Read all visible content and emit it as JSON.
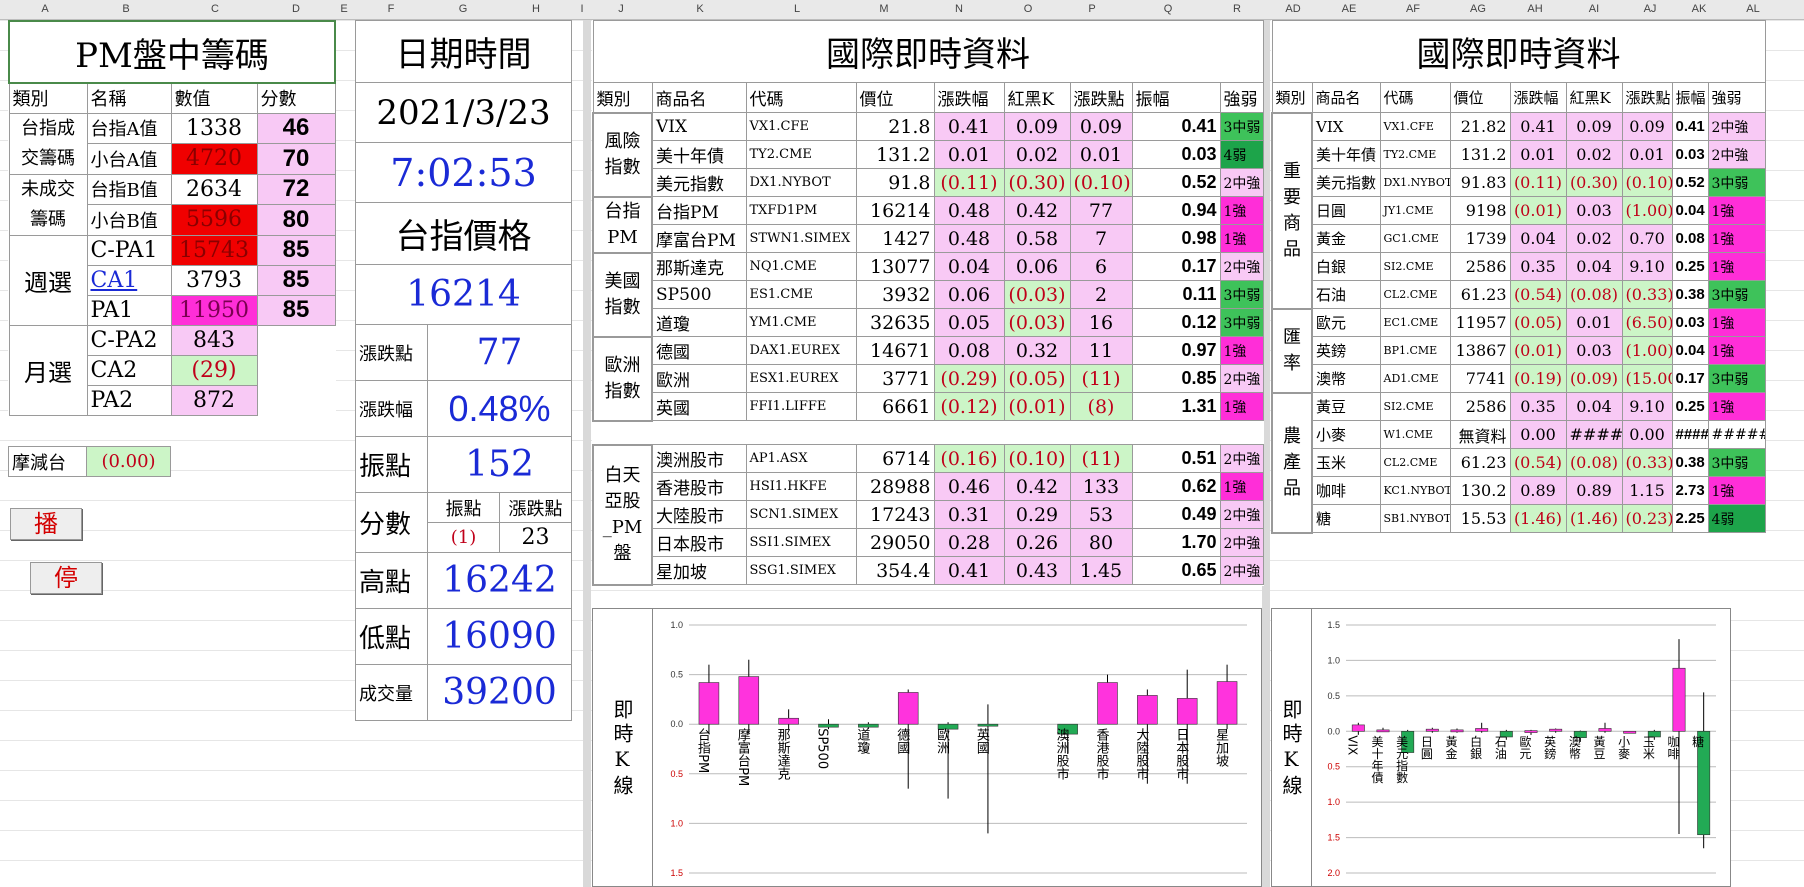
{
  "column_letters": [
    "A",
    "B",
    "C",
    "D",
    "E",
    "F",
    "G",
    "H",
    "I",
    "J",
    "K",
    "L",
    "M",
    "N",
    "O",
    "P",
    "Q",
    "R",
    "AD",
    "AE",
    "AF",
    "AG",
    "AH",
    "AI",
    "AJ",
    "AK",
    "AL"
  ],
  "left": {
    "title": "PM盤中籌碼",
    "headers": [
      "類別",
      "名稱",
      "數值",
      "分數"
    ],
    "group_a": {
      "cat": "台指成交籌碼",
      "rows": [
        {
          "name": "台指A值",
          "value": "1338",
          "score": "46"
        },
        {
          "name": "小台A值",
          "value": "4720",
          "score": "70"
        }
      ]
    },
    "group_b": {
      "cat": "未成交籌碼",
      "rows": [
        {
          "name": "台指B值",
          "value": "2634",
          "score": "72"
        },
        {
          "name": "小台B值",
          "value": "5596",
          "score": "80"
        }
      ]
    },
    "weekly": {
      "cat": "週選",
      "rows": [
        {
          "name": "C-PA1",
          "value": "15743",
          "score": "85"
        },
        {
          "name": "CA1",
          "value": "3793",
          "score": "85"
        },
        {
          "name": "PA1",
          "value": "11950",
          "score": "85"
        }
      ]
    },
    "monthly": {
      "cat": "月選",
      "rows": [
        {
          "name": "C-PA2",
          "value": "843"
        },
        {
          "name": "CA2",
          "value": "(29)"
        },
        {
          "name": "PA2",
          "value": "872"
        }
      ]
    },
    "mojian": {
      "label": "摩減台",
      "value": "(0.00)"
    },
    "play_label": "播",
    "stop_label": "停"
  },
  "mid": {
    "title": "日期時間",
    "date": "2021/3/23",
    "time": "7:02:53",
    "price_title": "台指價格",
    "price": "16214",
    "change_pts_label": "漲跌點",
    "change_pts": "77",
    "change_pct_label": "漲跌幅",
    "change_pct": "0.48%",
    "amplitude_label": "振點",
    "amplitude": "152",
    "score_label": "分數",
    "score_sub1": "振點",
    "score_sub2": "漲跌點",
    "score_val1": "(1)",
    "score_val2": "23",
    "high_label": "高點",
    "high": "16242",
    "low_label": "低點",
    "low": "16090",
    "volume_label": "成交量",
    "volume": "39200"
  },
  "intl1": {
    "title": "國際即時資料",
    "headers": [
      "類別",
      "商品名",
      "代碼",
      "價位",
      "漲跌幅",
      "紅黑K",
      "漲跌點",
      "振幅",
      "強弱"
    ],
    "groups": [
      {
        "cat": "風險指數",
        "rows": [
          {
            "name": "VIX",
            "code": "VX1.CFE",
            "price": "21.8",
            "pct": "0.41",
            "k": "0.09",
            "pts": "0.09",
            "amp": "0.41",
            "str": "3中弱"
          },
          {
            "name": "美十年債",
            "code": "TY2.CME",
            "price": "131.2",
            "pct": "0.01",
            "k": "0.02",
            "pts": "0.01",
            "amp": "0.03",
            "str": "4弱"
          },
          {
            "name": "美元指數",
            "code": "DX1.NYBOT",
            "price": "91.8",
            "pct": "(0.11)",
            "k": "(0.30)",
            "pts": "(0.10)",
            "amp": "0.52",
            "str": "2中強"
          }
        ]
      },
      {
        "cat": "台指PM",
        "rows": [
          {
            "name": "台指PM",
            "code": "TXFD1PM",
            "price": "16214",
            "pct": "0.48",
            "k": "0.42",
            "pts": "77",
            "amp": "0.94",
            "str": "1強"
          },
          {
            "name": "摩富台PM",
            "code": "STWN1.SIMEX",
            "price": "1427",
            "pct": "0.48",
            "k": "0.58",
            "pts": "7",
            "amp": "0.98",
            "str": "1強"
          }
        ]
      },
      {
        "cat": "美國指數",
        "rows": [
          {
            "name": "那斯達克",
            "code": "NQ1.CME",
            "price": "13077",
            "pct": "0.04",
            "k": "0.06",
            "pts": "6",
            "amp": "0.17",
            "str": "2中強"
          },
          {
            "name": "SP500",
            "code": "ES1.CME",
            "price": "3932",
            "pct": "0.06",
            "k": "(0.03)",
            "pts": "2",
            "amp": "0.11",
            "str": "3中弱"
          },
          {
            "name": "道瓊",
            "code": "YM1.CME",
            "price": "32635",
            "pct": "0.05",
            "k": "(0.03)",
            "pts": "16",
            "amp": "0.12",
            "str": "3中弱"
          }
        ]
      },
      {
        "cat": "歐洲指數",
        "rows": [
          {
            "name": "德國",
            "code": "DAX1.EUREX",
            "price": "14671",
            "pct": "0.08",
            "k": "0.32",
            "pts": "11",
            "amp": "0.97",
            "str": "1強"
          },
          {
            "name": "歐洲",
            "code": "ESX1.EUREX",
            "price": "3771",
            "pct": "(0.29)",
            "k": "(0.05)",
            "pts": "(11)",
            "amp": "0.85",
            "str": "2中強"
          },
          {
            "name": "英國",
            "code": "FFI1.LIFFE",
            "price": "6661",
            "pct": "(0.12)",
            "k": "(0.01)",
            "pts": "(8)",
            "amp": "1.31",
            "str": "1強"
          }
        ]
      },
      {
        "cat": "白天亞股_PM盤",
        "rows": [
          {
            "name": "澳洲股市",
            "code": "AP1.ASX",
            "price": "6714",
            "pct": "(0.16)",
            "k": "(0.10)",
            "pts": "(11)",
            "amp": "0.51",
            "str": "2中強"
          },
          {
            "name": "香港股市",
            "code": "HSI1.HKFE",
            "price": "28988",
            "pct": "0.46",
            "k": "0.42",
            "pts": "133",
            "amp": "0.62",
            "str": "1強"
          },
          {
            "name": "大陸股市",
            "code": "SCN1.SIMEX",
            "price": "17243",
            "pct": "0.31",
            "k": "0.29",
            "pts": "53",
            "amp": "0.49",
            "str": "2中強"
          },
          {
            "name": "日本股市",
            "code": "SSI1.SIMEX",
            "price": "29050",
            "pct": "0.28",
            "k": "0.26",
            "pts": "80",
            "amp": "1.70",
            "str": "2中強"
          },
          {
            "name": "星加坡",
            "code": "SSG1.SIMEX",
            "price": "354.4",
            "pct": "0.41",
            "k": "0.43",
            "pts": "1.45",
            "amp": "0.65",
            "str": "2中強"
          }
        ]
      }
    ],
    "chart_label": "即時K線"
  },
  "intl2": {
    "title": "國際即時資料",
    "headers": [
      "類別",
      "商品名",
      "代碼",
      "價位",
      "漲跌幅",
      "紅黑K",
      "漲跌點",
      "振幅",
      "強弱"
    ],
    "groups": [
      {
        "cat": "重要商品",
        "rows": [
          {
            "name": "VIX",
            "code": "VX1.CFE",
            "price": "21.82",
            "pct": "0.41",
            "k": "0.09",
            "pts": "0.09",
            "amp": "0.41",
            "str": "2中強"
          },
          {
            "name": "美十年債",
            "code": "TY2.CME",
            "price": "131.2",
            "pct": "0.01",
            "k": "0.02",
            "pts": "0.01",
            "amp": "0.03",
            "str": "2中強"
          },
          {
            "name": "美元指數",
            "code": "DX1.NYBOT",
            "price": "91.83",
            "pct": "(0.11)",
            "k": "(0.30)",
            "pts": "(0.10)",
            "amp": "0.52",
            "str": "3中弱"
          },
          {
            "name": "日圓",
            "code": "JY1.CME",
            "price": "9198",
            "pct": "(0.01)",
            "k": "0.03",
            "pts": "(1.00)",
            "amp": "0.04",
            "str": "1強"
          },
          {
            "name": "黃金",
            "code": "GC1.CME",
            "price": "1739",
            "pct": "0.04",
            "k": "0.02",
            "pts": "0.70",
            "amp": "0.08",
            "str": "1強"
          },
          {
            "name": "白銀",
            "code": "SI2.CME",
            "price": "2586",
            "pct": "0.35",
            "k": "0.04",
            "pts": "9.10",
            "amp": "0.25",
            "str": "1強"
          },
          {
            "name": "石油",
            "code": "CL2.CME",
            "price": "61.23",
            "pct": "(0.54)",
            "k": "(0.08)",
            "pts": "(0.33)",
            "amp": "0.38",
            "str": "3中弱"
          }
        ]
      },
      {
        "cat": "匯率",
        "rows": [
          {
            "name": "歐元",
            "code": "EC1.CME",
            "price": "11957",
            "pct": "(0.05)",
            "k": "0.01",
            "pts": "(6.50)",
            "amp": "0.03",
            "str": "1強"
          },
          {
            "name": "英鎊",
            "code": "BP1.CME",
            "price": "13867",
            "pct": "(0.01)",
            "k": "0.03",
            "pts": "(1.00)",
            "amp": "0.04",
            "str": "1強"
          },
          {
            "name": "澳幣",
            "code": "AD1.CME",
            "price": "7741",
            "pct": "(0.19)",
            "k": "(0.09)",
            "pts": "(15.00)",
            "amp": "0.17",
            "str": "3中弱"
          }
        ]
      },
      {
        "cat": "農產品",
        "rows": [
          {
            "name": "黃豆",
            "code": "SI2.CME",
            "price": "2586",
            "pct": "0.35",
            "k": "0.04",
            "pts": "9.10",
            "amp": "0.25",
            "str": "1強"
          },
          {
            "name": "小麥",
            "code": "W1.CME",
            "price": "無資料",
            "pct": "0.00",
            "k": "#####",
            "pts": "0.00",
            "amp": "####",
            "str": "######"
          },
          {
            "name": "玉米",
            "code": "CL2.CME",
            "price": "61.23",
            "pct": "(0.54)",
            "k": "(0.08)",
            "pts": "(0.33)",
            "amp": "0.38",
            "str": "3中弱"
          },
          {
            "name": "咖啡",
            "code": "KC1.NYBOT",
            "price": "130.2",
            "pct": "0.89",
            "k": "0.89",
            "pts": "1.15",
            "amp": "2.73",
            "str": "1強"
          },
          {
            "name": "糖",
            "code": "SB1.NYBOT",
            "price": "15.53",
            "pct": "(1.46)",
            "k": "(1.46)",
            "pts": "(0.23)",
            "amp": "2.25",
            "str": "4弱"
          }
        ]
      }
    ],
    "chart_label": "即時K線"
  },
  "chart_data": [
    {
      "type": "candlestick",
      "ylim": [
        -1.5,
        1.0
      ],
      "yticks": [
        "1.0",
        "0.5",
        "0.0",
        "0.5",
        "1.0",
        "1.5"
      ],
      "categories": [
        "台指PM",
        "摩富台PM",
        "那斯達克",
        "SP500",
        "道瓊",
        "德國",
        "歐洲",
        "英國",
        "",
        "澳洲股市",
        "香港股市",
        "大陸股市",
        "日本股市",
        "星加坡"
      ],
      "values": [
        0.42,
        0.48,
        0.06,
        -0.03,
        -0.03,
        0.32,
        -0.05,
        -0.01,
        null,
        -0.1,
        0.42,
        0.29,
        0.26,
        0.43
      ],
      "high": [
        0.6,
        0.65,
        0.15,
        0.05,
        0.02,
        0.35,
        0.02,
        0.2,
        null,
        0.0,
        0.5,
        0.35,
        0.55,
        0.6
      ],
      "low": [
        -0.1,
        -0.1,
        -0.05,
        -0.05,
        -0.05,
        -0.65,
        -0.75,
        -1.1,
        null,
        -0.3,
        0.0,
        -0.6,
        -0.6,
        -0.05
      ],
      "colors": {
        "up": "#ff33dd",
        "down": "#22aa55"
      }
    },
    {
      "type": "candlestick",
      "ylim": [
        -2.0,
        1.5
      ],
      "yticks": [
        "1.5",
        "1.0",
        "0.5",
        "0.0",
        "0.5",
        "1.0",
        "1.5",
        "2.0"
      ],
      "categories": [
        "VIX",
        "美十年債",
        "美元指數",
        "日圓",
        "黃金",
        "白銀",
        "石油",
        "歐元",
        "英鎊",
        "澳幣",
        "黃豆",
        "小麥",
        "玉米",
        "咖啡",
        "糖"
      ],
      "values": [
        0.09,
        0.02,
        -0.3,
        0.03,
        0.02,
        0.04,
        -0.08,
        0.01,
        0.03,
        -0.09,
        0.04,
        0.0,
        -0.08,
        0.89,
        -1.46
      ],
      "high": [
        0.12,
        0.05,
        0.02,
        0.05,
        0.04,
        0.12,
        0.02,
        0.02,
        0.04,
        0.01,
        0.12,
        0.0,
        0.02,
        1.3,
        0.55
      ],
      "low": [
        -0.05,
        -0.01,
        -0.32,
        -0.02,
        -0.02,
        -0.02,
        -0.12,
        -0.05,
        -0.02,
        -0.15,
        -0.02,
        0.0,
        -0.12,
        -1.45,
        -1.65
      ],
      "colors": {
        "up": "#ff33dd",
        "down": "#22aa55"
      }
    }
  ]
}
